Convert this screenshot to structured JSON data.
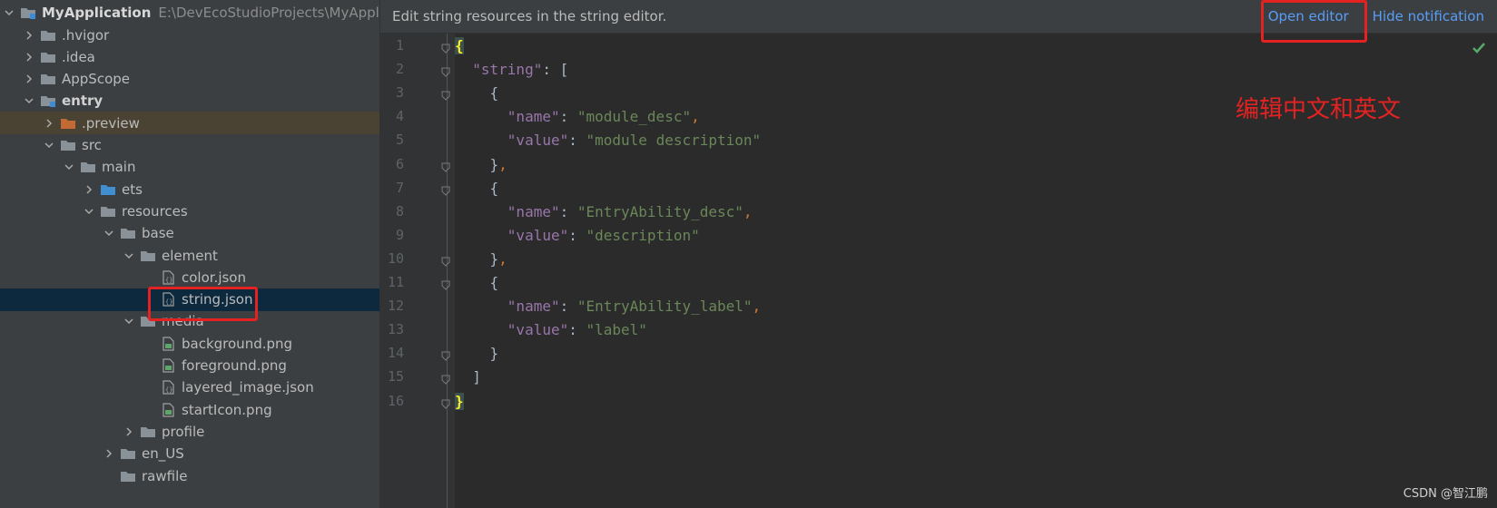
{
  "tree": {
    "root_name": "MyApplication",
    "root_path": "E:\\DevEcoStudioProjects\\MyApplica",
    "items": [
      {
        "label": ".hvigor",
        "depth": 1,
        "arrow": "right",
        "icon": "folder-icon"
      },
      {
        "label": ".idea",
        "depth": 1,
        "arrow": "right",
        "icon": "folder-icon"
      },
      {
        "label": "AppScope",
        "depth": 1,
        "arrow": "right",
        "icon": "folder-icon"
      },
      {
        "label": "entry",
        "depth": 1,
        "arrow": "down",
        "icon": "module-folder-icon"
      },
      {
        "label": ".preview",
        "depth": 2,
        "arrow": "right",
        "icon": "orange-folder-icon"
      },
      {
        "label": "src",
        "depth": 2,
        "arrow": "down",
        "icon": "folder-icon"
      },
      {
        "label": "main",
        "depth": 3,
        "arrow": "down",
        "icon": "folder-icon"
      },
      {
        "label": "ets",
        "depth": 4,
        "arrow": "right",
        "icon": "blue-folder-icon"
      },
      {
        "label": "resources",
        "depth": 4,
        "arrow": "down",
        "icon": "folder-icon"
      },
      {
        "label": "base",
        "depth": 5,
        "arrow": "down",
        "icon": "folder-icon"
      },
      {
        "label": "element",
        "depth": 6,
        "arrow": "down",
        "icon": "folder-icon"
      },
      {
        "label": "color.json",
        "depth": 7,
        "arrow": "none",
        "icon": "json-file-icon"
      },
      {
        "label": "string.json",
        "depth": 7,
        "arrow": "none",
        "icon": "json-file-icon"
      },
      {
        "label": "media",
        "depth": 6,
        "arrow": "down",
        "icon": "folder-icon"
      },
      {
        "label": "background.png",
        "depth": 7,
        "arrow": "none",
        "icon": "image-file-icon"
      },
      {
        "label": "foreground.png",
        "depth": 7,
        "arrow": "none",
        "icon": "image-file-icon"
      },
      {
        "label": "layered_image.json",
        "depth": 7,
        "arrow": "none",
        "icon": "json-file-icon"
      },
      {
        "label": "startIcon.png",
        "depth": 7,
        "arrow": "none",
        "icon": "image-file-icon"
      },
      {
        "label": "profile",
        "depth": 6,
        "arrow": "right",
        "icon": "folder-icon"
      },
      {
        "label": "en_US",
        "depth": 5,
        "arrow": "right",
        "icon": "folder-icon"
      },
      {
        "label": "rawfile",
        "depth": 5,
        "arrow": "none",
        "icon": "folder-icon"
      }
    ]
  },
  "notification": {
    "message": "Edit string resources in the string editor.",
    "open_editor": "Open editor",
    "hide_notification": "Hide notification"
  },
  "editor": {
    "line_numbers": [
      "1",
      "2",
      "3",
      "4",
      "5",
      "6",
      "7",
      "8",
      "9",
      "10",
      "11",
      "12",
      "13",
      "14",
      "15",
      "16"
    ],
    "lines": [
      [
        {
          "t": "{",
          "c": "brace-hl"
        }
      ],
      [
        {
          "t": "  "
        },
        {
          "t": "\"string\"",
          "c": "k"
        },
        {
          "t": ": ["
        }
      ],
      [
        {
          "t": "    {"
        }
      ],
      [
        {
          "t": "      "
        },
        {
          "t": "\"name\"",
          "c": "k"
        },
        {
          "t": ": "
        },
        {
          "t": "\"module_desc\"",
          "c": "s"
        },
        {
          "t": ",",
          "c": "p"
        }
      ],
      [
        {
          "t": "      "
        },
        {
          "t": "\"value\"",
          "c": "k"
        },
        {
          "t": ": "
        },
        {
          "t": "\"module description\"",
          "c": "s"
        }
      ],
      [
        {
          "t": "    }"
        },
        {
          "t": ",",
          "c": "p"
        }
      ],
      [
        {
          "t": "    {"
        }
      ],
      [
        {
          "t": "      "
        },
        {
          "t": "\"name\"",
          "c": "k"
        },
        {
          "t": ": "
        },
        {
          "t": "\"EntryAbility_desc\"",
          "c": "s"
        },
        {
          "t": ",",
          "c": "p"
        }
      ],
      [
        {
          "t": "      "
        },
        {
          "t": "\"value\"",
          "c": "k"
        },
        {
          "t": ": "
        },
        {
          "t": "\"description\"",
          "c": "s"
        }
      ],
      [
        {
          "t": "    }"
        },
        {
          "t": ",",
          "c": "p"
        }
      ],
      [
        {
          "t": "    {"
        }
      ],
      [
        {
          "t": "      "
        },
        {
          "t": "\"name\"",
          "c": "k"
        },
        {
          "t": ": "
        },
        {
          "t": "\"EntryAbility_label\"",
          "c": "s"
        },
        {
          "t": ",",
          "c": "p"
        }
      ],
      [
        {
          "t": "      "
        },
        {
          "t": "\"value\"",
          "c": "k"
        },
        {
          "t": ": "
        },
        {
          "t": "\"label\"",
          "c": "s"
        }
      ],
      [
        {
          "t": "    }"
        }
      ],
      [
        {
          "t": "  ]"
        }
      ],
      [
        {
          "t": "}",
          "c": "brace-hl"
        }
      ]
    ],
    "fold_lines": [
      0,
      1,
      2,
      5,
      6,
      9,
      10,
      13,
      14,
      15
    ]
  },
  "annotation": "编辑中文和英文",
  "watermark": "CSDN @智江鹏",
  "colors": {
    "accent": "#589df6",
    "annotation_red": "#e52222",
    "keyword": "#9876aa",
    "string": "#6a8759"
  }
}
